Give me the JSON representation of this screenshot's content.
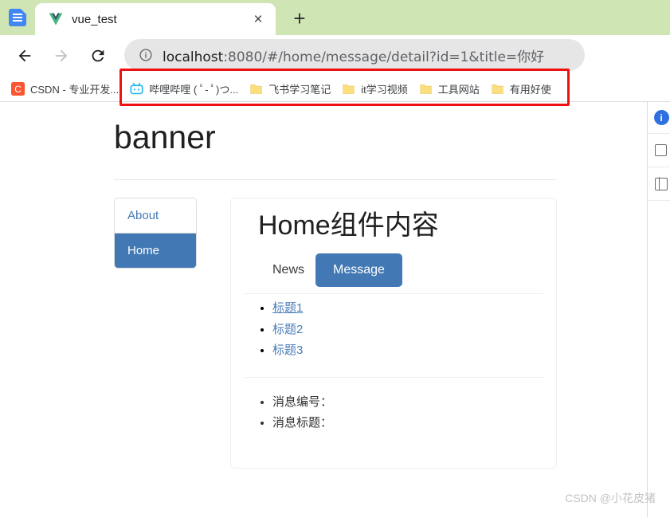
{
  "browser": {
    "tabstrip": {
      "tab_search_icon": "docs-icon",
      "tabs": [
        {
          "title": "vue_test",
          "favicon": "vue-logo-icon",
          "close_label": "×"
        }
      ],
      "new_tab_label": "+"
    },
    "toolbar": {
      "back_label": "back-arrow",
      "forward_label": "forward-arrow",
      "reload_label": "reload-arrow",
      "omnibox": {
        "site_info_icon": "info-circle-icon",
        "url_host": "localhost",
        "url_rest": ":8080/#/home/message/detail?id=1&title=你好",
        "full_url": "localhost:8080/#/home/message/detail?id=1&title=你好"
      },
      "highlight_color": "#ee1111"
    },
    "bookmarks": [
      {
        "label": "CSDN - 专业开发...",
        "icon": "csdn-icon"
      },
      {
        "label": "哔哩哔哩 ( ﾟ- ﾟ)つ...",
        "icon": "bilibili-icon"
      },
      {
        "label": "飞书学习笔记",
        "icon": "folder-icon"
      },
      {
        "label": "it学习视频",
        "icon": "folder-icon"
      },
      {
        "label": "工具网站",
        "icon": "folder-icon"
      },
      {
        "label": "有用好使",
        "icon": "folder-icon"
      }
    ]
  },
  "page": {
    "banner": "banner",
    "nav": {
      "items": [
        {
          "label": "About",
          "active": false
        },
        {
          "label": "Home",
          "active": true
        }
      ]
    },
    "main": {
      "title": "Home组件内容",
      "tabs": [
        {
          "label": "News",
          "active": false
        },
        {
          "label": "Message",
          "active": true
        }
      ],
      "messages": [
        {
          "label": "标题1",
          "hovered": true
        },
        {
          "label": "标题2",
          "hovered": false
        },
        {
          "label": "标题3",
          "hovered": false
        }
      ],
      "detail": [
        "消息编号：",
        "消息标题："
      ]
    }
  },
  "side_panel": {
    "items": [
      {
        "icon": "blue-info-badge-icon",
        "label": "i"
      },
      {
        "icon": "square-outline-icon"
      },
      {
        "icon": "split-panel-icon"
      }
    ]
  },
  "watermark": "CSDN @小花皮猪",
  "colors": {
    "tabstrip_bg": "#cfe5b4",
    "accent_blue": "#4279b4",
    "highlight_red": "#ee1111",
    "link_blue": "#4a7ebb"
  }
}
